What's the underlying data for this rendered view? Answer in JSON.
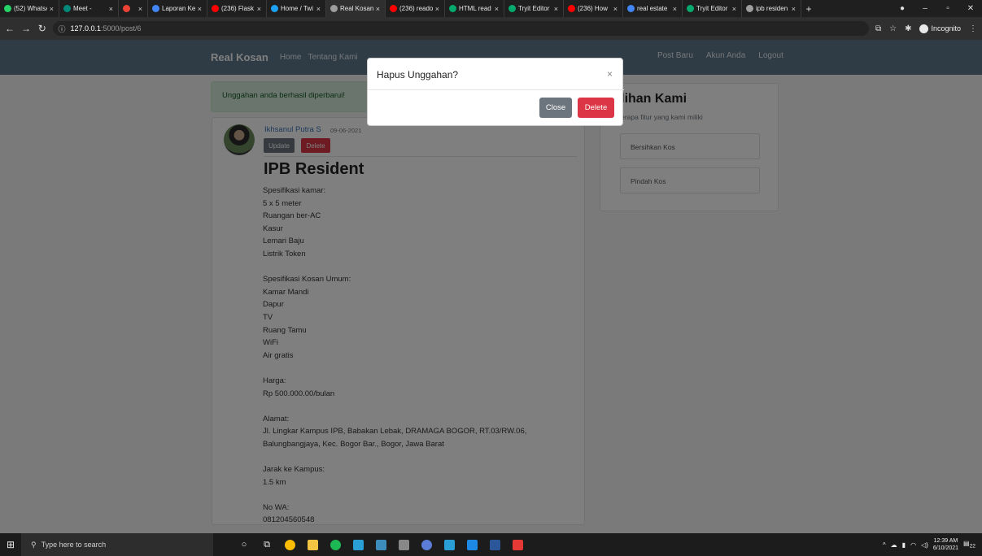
{
  "browser": {
    "tabs": [
      {
        "title": "(52) WhatsA",
        "color": "#25d366",
        "active": false
      },
      {
        "title": "Meet -",
        "color": "#00897b",
        "active": false
      },
      {
        "title": "",
        "color": "#ea4335",
        "active": false
      },
      {
        "title": "Laporan Ke",
        "color": "#4285f4",
        "active": false
      },
      {
        "title": "(236) Flask",
        "color": "#ff0000",
        "active": false
      },
      {
        "title": "Home / Twi",
        "color": "#1da1f2",
        "active": false
      },
      {
        "title": "Real Kosan",
        "color": "#9e9e9e",
        "active": true
      },
      {
        "title": "(236) reado",
        "color": "#ff0000",
        "active": false
      },
      {
        "title": "HTML read",
        "color": "#04aa6d",
        "active": false
      },
      {
        "title": "Tryit Editor",
        "color": "#04aa6d",
        "active": false
      },
      {
        "title": "(236) How",
        "color": "#ff0000",
        "active": false
      },
      {
        "title": "real estate",
        "color": "#4285f4",
        "active": false
      },
      {
        "title": "Tryit Editor",
        "color": "#04aa6d",
        "active": false
      },
      {
        "title": "ipb residen",
        "color": "#9e9e9e",
        "active": false
      }
    ],
    "new_tab": "+",
    "url_host": "127.0.0.1",
    "url_path": ":5000/post/6",
    "incognito_label": "Incognito"
  },
  "navbar": {
    "brand": "Real Kosan",
    "links_left": [
      "Home",
      "Tentang Kami"
    ],
    "links_right": [
      "Post Baru",
      "Akun Anda",
      "Logout"
    ]
  },
  "alert": "Unggahan anda berhasil diperbarui!",
  "post": {
    "author": "Ikhsanul Putra S",
    "date": "09-06-2021",
    "update_label": "Update",
    "delete_label": "Delete",
    "title": "IPB Resident",
    "lines": [
      "Spesifikasi kamar:",
      "5 x 5 meter",
      "Ruangan ber-AC",
      "Kasur",
      "Lemari Baju",
      "Listrik Token",
      "",
      "Spesifikasi Kosan Umum:",
      "Kamar Mandi",
      "Dapur",
      "TV",
      "Ruang Tamu",
      "WiFi",
      "Air gratis",
      "",
      "Harga:",
      "Rp 500.000.00/bulan",
      "",
      "Alamat:",
      "Jl. Lingkar Kampus IPB, Babakan Lebak, DRAMAGA BOGOR, RT.03/RW.06,",
      "Balungbangjaya, Kec. Bogor Bar., Bogor, Jawa Barat",
      "",
      "Jarak ke Kampus:",
      "1.5 km",
      "",
      "No WA:",
      "081204560548"
    ]
  },
  "sidebar": {
    "title": "Pilihan Kami",
    "subtitle": "Beberapa fitur yang kami miliki",
    "items": [
      "Bersihkan Kos",
      "Pindah Kos"
    ]
  },
  "modal": {
    "title": "Hapus Unggahan?",
    "close_x": "×",
    "close_label": "Close",
    "delete_label": "Delete"
  },
  "taskbar": {
    "search_placeholder": "Type here to search",
    "time": "12:39 AM",
    "date": "6/10/2021",
    "notification_count": "22"
  }
}
